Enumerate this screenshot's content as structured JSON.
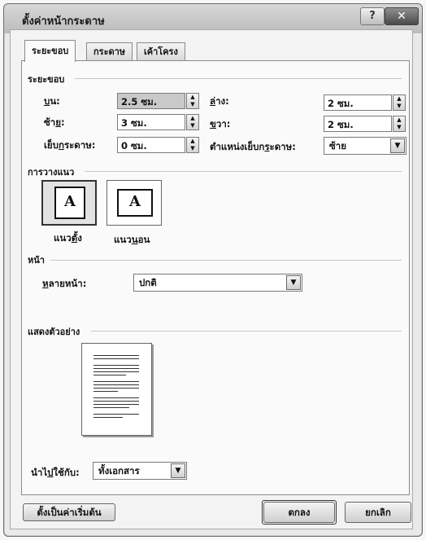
{
  "window": {
    "title": "ตั้งค่าหน้ากระดาษ",
    "help": "?",
    "close": "✕"
  },
  "tabs": [
    {
      "label": "ระยะขอบ",
      "active": true
    },
    {
      "label": "กระดาษ",
      "active": false
    },
    {
      "label": "เค้าโครง",
      "active": false
    }
  ],
  "margins": {
    "header": "ระยะขอบ",
    "top": {
      "label_pre": "",
      "label_u": "บ",
      "label_post": "น:",
      "value": "2.5 ซม."
    },
    "bottom": {
      "label_pre": "",
      "label_u": "ล",
      "label_post": "่าง:",
      "value": "2 ซม."
    },
    "left": {
      "label_pre": "ซ้า",
      "label_u": "ย",
      "label_post": ":",
      "value": "3 ซม."
    },
    "right": {
      "label_pre": "",
      "label_u": "ข",
      "label_post": "วา:",
      "value": "2 ซม."
    },
    "gutter": {
      "label_pre": "เย็บ",
      "label_u": "ก",
      "label_post": "ระดาษ:",
      "value": "0 ซม."
    },
    "gutter_position": {
      "label_pre": "ตำแหน่งเย็บก",
      "label_u": "ร",
      "label_post": "ะดาษ:",
      "value": "ซ้าย"
    }
  },
  "orientation": {
    "header": "การวางแนว",
    "portrait": {
      "label_pre": "แนว",
      "label_u": "ต",
      "label_post": "ั้ง",
      "glyph": "A",
      "selected": true
    },
    "landscape": {
      "label_pre": "แนว",
      "label_u": "น",
      "label_post": "อน",
      "glyph": "A",
      "selected": false
    }
  },
  "pages": {
    "header": "หน้า",
    "multiple_label_pre": "",
    "multiple_label_u": "ห",
    "multiple_label_post": "ลายหน้า:",
    "multiple_value": "ปกติ"
  },
  "preview": {
    "header": "แสดงตัวอย่าง",
    "apply_to_label_pre": "นำไ",
    "apply_to_label_u": "ป",
    "apply_to_label_post": "ใช้กับ:",
    "apply_to_value": "ทั้งเอกสาร"
  },
  "buttons": {
    "set_default": "ตั้งเป็นค่าเริ่มต้น",
    "ok": "ตกลง",
    "cancel": "ยกเลิก"
  },
  "icons": {
    "spin_up": "▲",
    "spin_down": "▼",
    "dropdown": "▼"
  }
}
